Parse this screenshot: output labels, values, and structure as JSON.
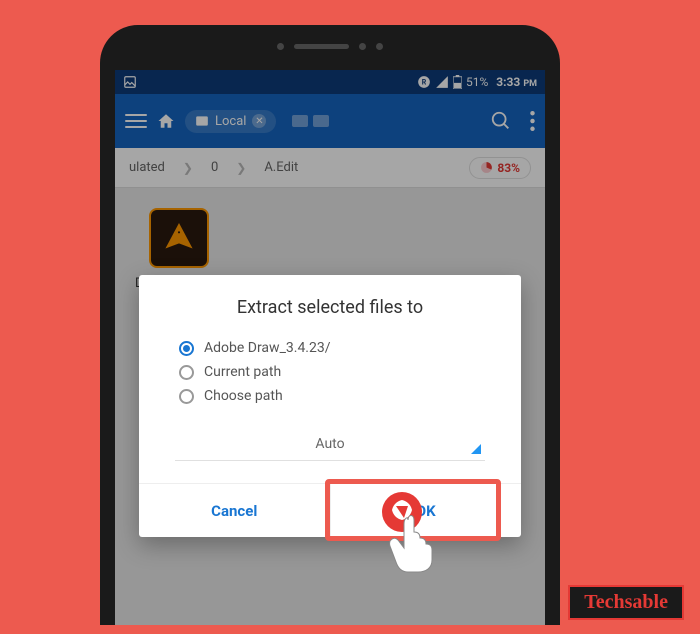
{
  "status": {
    "battery_text": "51%",
    "time": "3:33",
    "time_suffix": "PM"
  },
  "appbar": {
    "location_label": "Local"
  },
  "breadcrumb": {
    "seg1": "ulated",
    "seg2": "0",
    "seg3": "A.Edit",
    "storage_percent": "83%"
  },
  "content": {
    "file_label": "Dra"
  },
  "dialog": {
    "title": "Extract selected files to",
    "options": [
      {
        "label": "Adobe Draw_3.4.23/",
        "selected": true
      },
      {
        "label": "Current path",
        "selected": false
      },
      {
        "label": "Choose path",
        "selected": false
      }
    ],
    "mode": "Auto",
    "cancel_label": "Cancel",
    "ok_label": "OK"
  },
  "watermark": "Techsable"
}
